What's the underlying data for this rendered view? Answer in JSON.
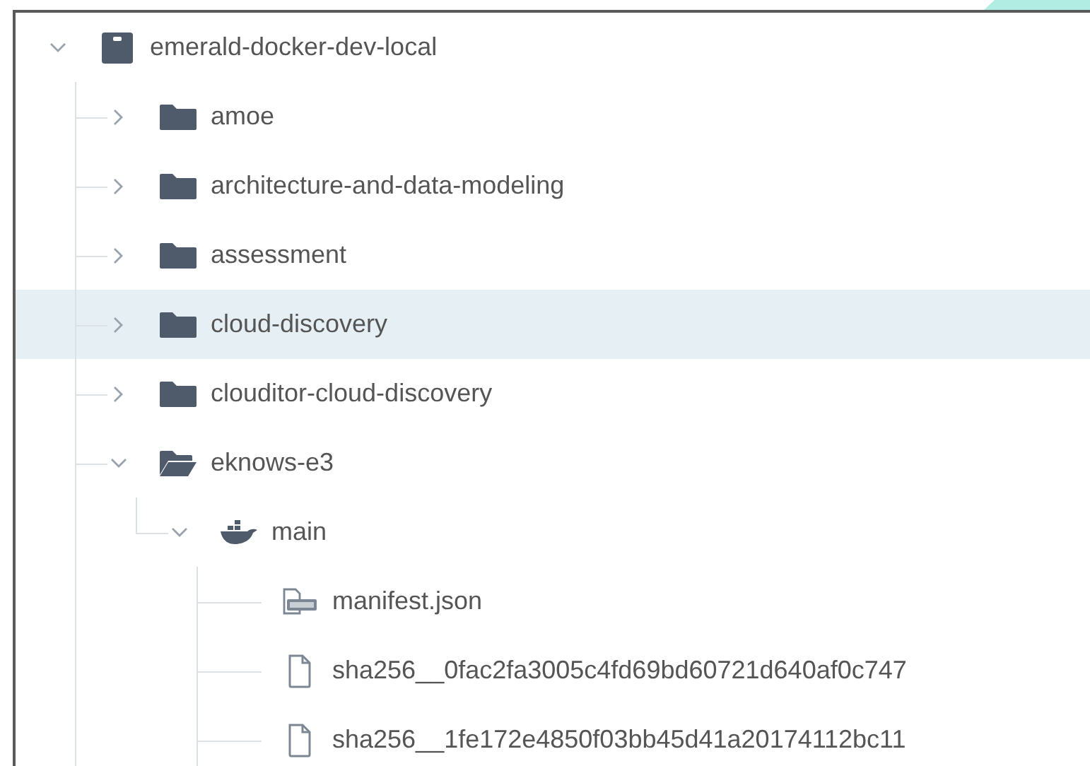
{
  "tree": [
    {
      "label": "emerald-docker-dev-local",
      "kind": "repository",
      "expanded": true,
      "selected": false,
      "children": [
        {
          "label": "amoe",
          "kind": "folder",
          "expanded": false,
          "selected": false
        },
        {
          "label": "architecture-and-data-modeling",
          "kind": "folder",
          "expanded": false,
          "selected": false
        },
        {
          "label": "assessment",
          "kind": "folder",
          "expanded": false,
          "selected": false
        },
        {
          "label": "cloud-discovery",
          "kind": "folder",
          "expanded": false,
          "selected": true
        },
        {
          "label": "clouditor-cloud-discovery",
          "kind": "folder",
          "expanded": false,
          "selected": false
        },
        {
          "label": "eknows-e3",
          "kind": "folder",
          "expanded": true,
          "selected": false,
          "children": [
            {
              "label": "main",
              "kind": "docker-image",
              "expanded": true,
              "selected": false,
              "children": [
                {
                  "label": "manifest.json",
                  "kind": "json-file",
                  "selected": false
                },
                {
                  "label": "sha256__0fac2fa3005c4fd69bd60721d640af0c747",
                  "kind": "file",
                  "selected": false
                },
                {
                  "label": "sha256__1fe172e4850f03bb45d41a20174112bc11",
                  "kind": "file",
                  "selected": false
                }
              ]
            }
          ]
        }
      ]
    }
  ]
}
